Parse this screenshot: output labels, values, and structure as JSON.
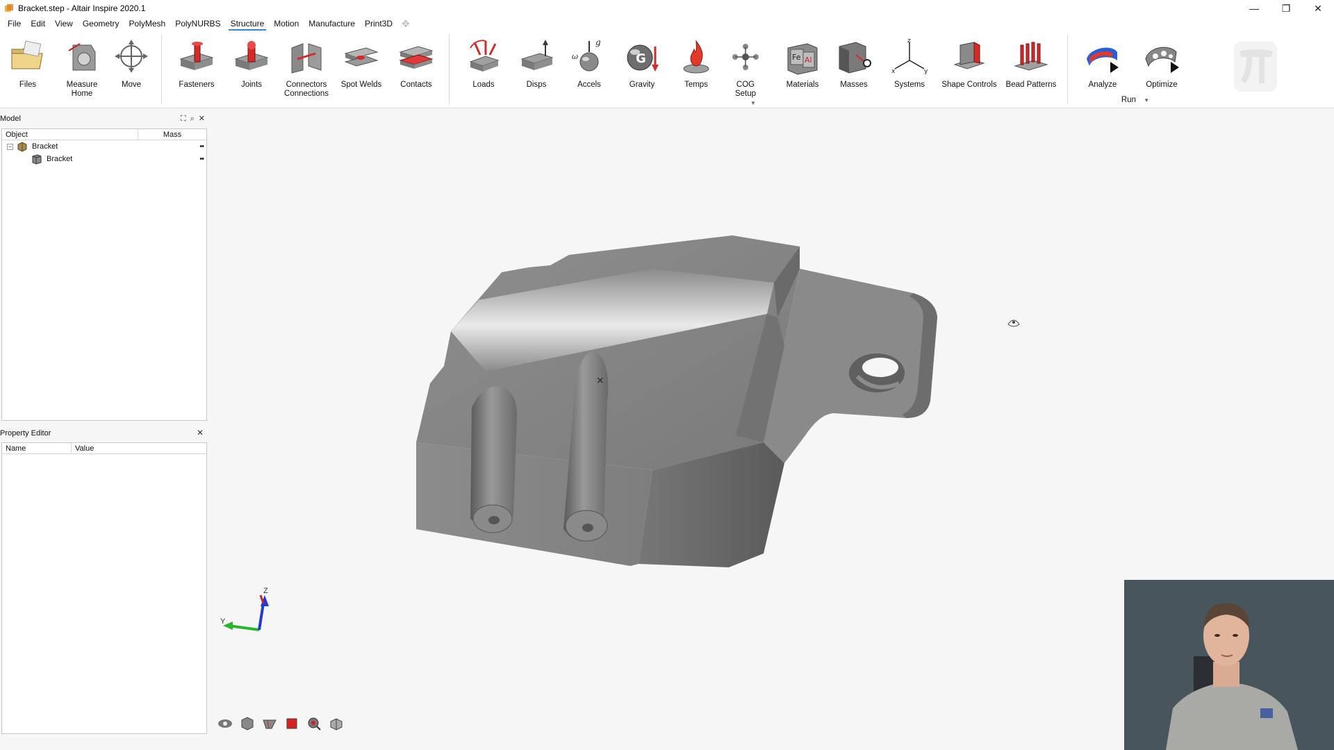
{
  "window": {
    "title": "Bracket.step - Altair Inspire 2020.1",
    "controls": [
      "—",
      "❐",
      "✕"
    ]
  },
  "menu": {
    "items": [
      "File",
      "Edit",
      "View",
      "Geometry",
      "PolyMesh",
      "PolyNURBS",
      "Structure",
      "Motion",
      "Manufacture",
      "Print3D"
    ],
    "active": "Structure"
  },
  "ribbon": {
    "files": "Files",
    "measure_line1": "Measure",
    "measure_line2": "Home",
    "move": "Move",
    "fasteners": "Fasteners",
    "joints": "Joints",
    "connectors_line1": "Connectors",
    "connectors_line2": "Connections",
    "spot_welds": "Spot Welds",
    "contacts": "Contacts",
    "loads": "Loads",
    "disps": "Disps",
    "accels": "Accels",
    "gravity": "Gravity",
    "temps": "Temps",
    "cog_line1": "COG",
    "cog_line2": "Setup",
    "materials": "Materials",
    "masses": "Masses",
    "systems": "Systems",
    "shape_controls": "Shape Controls",
    "bead_patterns": "Bead Patterns",
    "analyze": "Analyze",
    "optimize": "Optimize",
    "run": "Run"
  },
  "model_browser": {
    "title": "Model",
    "col_object": "Object",
    "col_mass": "Mass",
    "rows": [
      {
        "label": "Bracket",
        "dots": "••"
      },
      {
        "label": "Bracket",
        "dots": "••"
      }
    ]
  },
  "property_editor": {
    "title": "Property Editor",
    "col_name": "Name",
    "col_value": "Value"
  },
  "triad": {
    "z_label": "Z",
    "y_label": "Y"
  },
  "colors": {
    "accent": "#2a8bd6",
    "viewport_bg": "#f6f6f6",
    "part_gray": "#8c8c8c",
    "axis_z": "#1f3ad6",
    "axis_y": "#2cb52c",
    "axis_x": "#d62020"
  }
}
